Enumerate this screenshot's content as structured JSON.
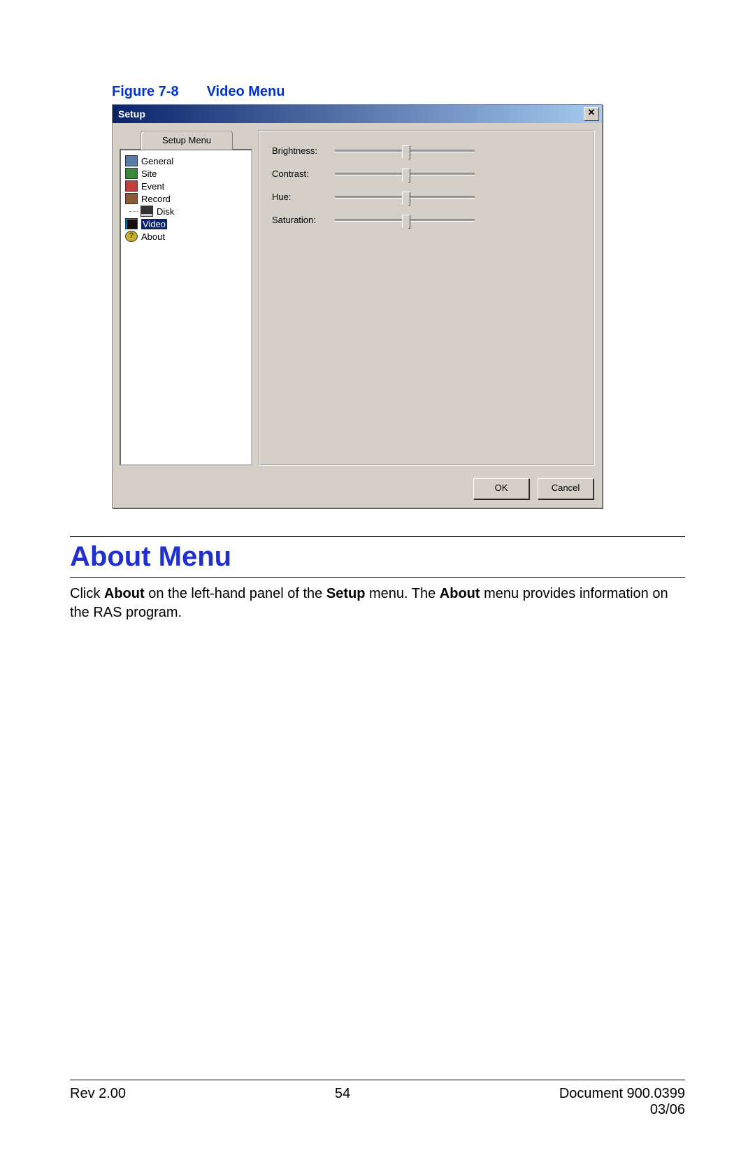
{
  "figure": {
    "label": "Figure 7-8",
    "title": "Video Menu"
  },
  "dialog": {
    "title": "Setup",
    "tab": "Setup Menu",
    "tree": [
      {
        "icon": "card-icon",
        "label": "General",
        "selected": false,
        "indent": false
      },
      {
        "icon": "globe-icon",
        "label": "Site",
        "selected": false,
        "indent": false
      },
      {
        "icon": "bell-icon",
        "label": "Event",
        "selected": false,
        "indent": false
      },
      {
        "icon": "record-icon",
        "label": "Record",
        "selected": false,
        "indent": false
      },
      {
        "icon": "disk-icon",
        "label": "Disk",
        "selected": false,
        "indent": true
      },
      {
        "icon": "monitor-icon",
        "label": "Video",
        "selected": true,
        "indent": false
      },
      {
        "icon": "help-icon",
        "label": "About",
        "selected": false,
        "indent": false
      }
    ],
    "sliders": [
      {
        "label": "Brightness:"
      },
      {
        "label": "Contrast:"
      },
      {
        "label": "Hue:"
      },
      {
        "label": "Saturation:"
      }
    ],
    "buttons": {
      "ok": "OK",
      "cancel": "Cancel"
    }
  },
  "section": {
    "heading": "About Menu",
    "paragraph_parts": {
      "p1": "Click ",
      "b1": "About",
      "p2": " on the left-hand panel of the ",
      "b2": "Setup",
      "p3": " menu. The ",
      "b3": "About",
      "p4": " menu provides information on the RAS program."
    }
  },
  "footer": {
    "rev": "Rev 2.00",
    "page": "54",
    "doc": "Document 900.0399",
    "date": "03/06"
  },
  "icon_colors": {
    "card-icon": "#5a7aa8",
    "globe-icon": "#3a8a3a",
    "bell-icon": "#c04040",
    "record-icon": "#8a5a3a",
    "disk-icon": "#303030",
    "monitor-icon": "#202020",
    "help-icon": "#c8b030"
  }
}
